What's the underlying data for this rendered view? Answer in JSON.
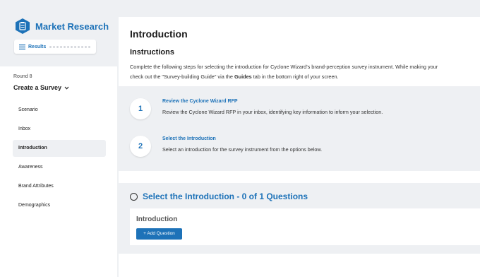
{
  "brand": {
    "title": "Market Research"
  },
  "results": {
    "label": "Results"
  },
  "sidebar": {
    "round_label": "Round 8",
    "section_title": "Create a Survey",
    "items": [
      {
        "label": "Scenario",
        "active": false
      },
      {
        "label": "Inbox",
        "active": false
      },
      {
        "label": "Introduction",
        "active": true
      },
      {
        "label": "Awareness",
        "active": false
      },
      {
        "label": "Brand Attributes",
        "active": false
      },
      {
        "label": "Demographics",
        "active": false
      }
    ]
  },
  "main": {
    "title": "Introduction",
    "instructions_title": "Instructions",
    "instructions_line1": "Complete the following steps for selecting the introduction for Cyclone Wizard's brand-perception survey instrument. While making your",
    "instructions_line2_pre": "check out the \"Survey-building Guide\" via the ",
    "instructions_guides": "Guides",
    "instructions_line2_post": " tab in the bottom right of your screen.",
    "steps": [
      {
        "number": "1",
        "title": "Review the Cyclone Wizard RFP",
        "description": "Review the Cyclone Wizard RFP in your inbox, identifying key information to inform your selection."
      },
      {
        "number": "2",
        "title": "Select the Introduction",
        "description": "Select an introduction for the survey instrument from the options below."
      }
    ],
    "section": {
      "title": "Select the Introduction - 0 of 1 Questions",
      "card_title": "Introduction",
      "add_button": "+ Add Question"
    }
  },
  "colors": {
    "accent": "#1d72b8",
    "background": "#eef0f3"
  }
}
